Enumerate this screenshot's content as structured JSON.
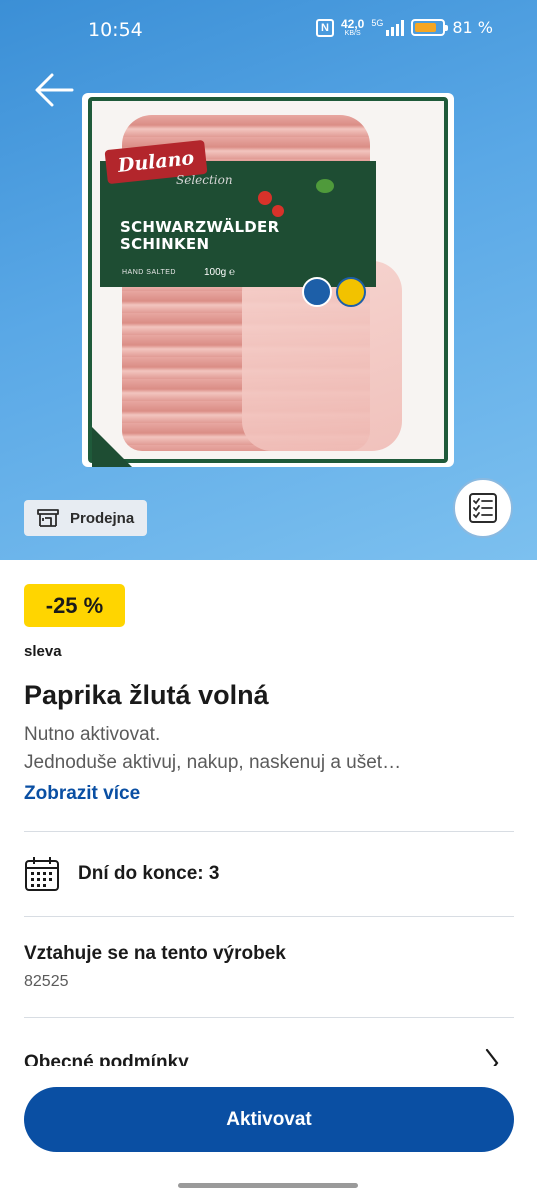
{
  "status_bar": {
    "time": "10:54",
    "net_speed_value": "42,0",
    "net_speed_unit": "KB/S",
    "network": "5G",
    "battery_percent": "81 %",
    "battery_level": 0.81
  },
  "hero": {
    "background_color": "#5aa8e6",
    "product_image": {
      "brand": "Dulano",
      "brand_sub": "Selection",
      "product_name_line1": "SCHWARZWÄLDER",
      "product_name_line2": "SCHINKEN",
      "hand_salted": "HAND SALTED",
      "weight": "100g ℮"
    },
    "store_chip_label": "Prodejna",
    "store_icon": "store-icon",
    "list_icon": "checklist-icon"
  },
  "offer": {
    "discount": "-25 %",
    "discount_label": "sleva",
    "title": "Paprika žlutá volná",
    "description_line1": "Nutno aktivovat.",
    "description_line2": "Jednoduše aktivuj, nakup, naskenuj a ušet…",
    "show_more": "Zobrazit více",
    "badge_color": "#ffd500",
    "accent_color": "#0a4fa3"
  },
  "details": {
    "days_left": "Dní do konce: 3",
    "applies_title": "Vztahuje se na tento výrobek",
    "applies_value": "82525",
    "terms_label": "Obecné podmínky"
  },
  "footer": {
    "activate_label": "Aktivovat"
  }
}
